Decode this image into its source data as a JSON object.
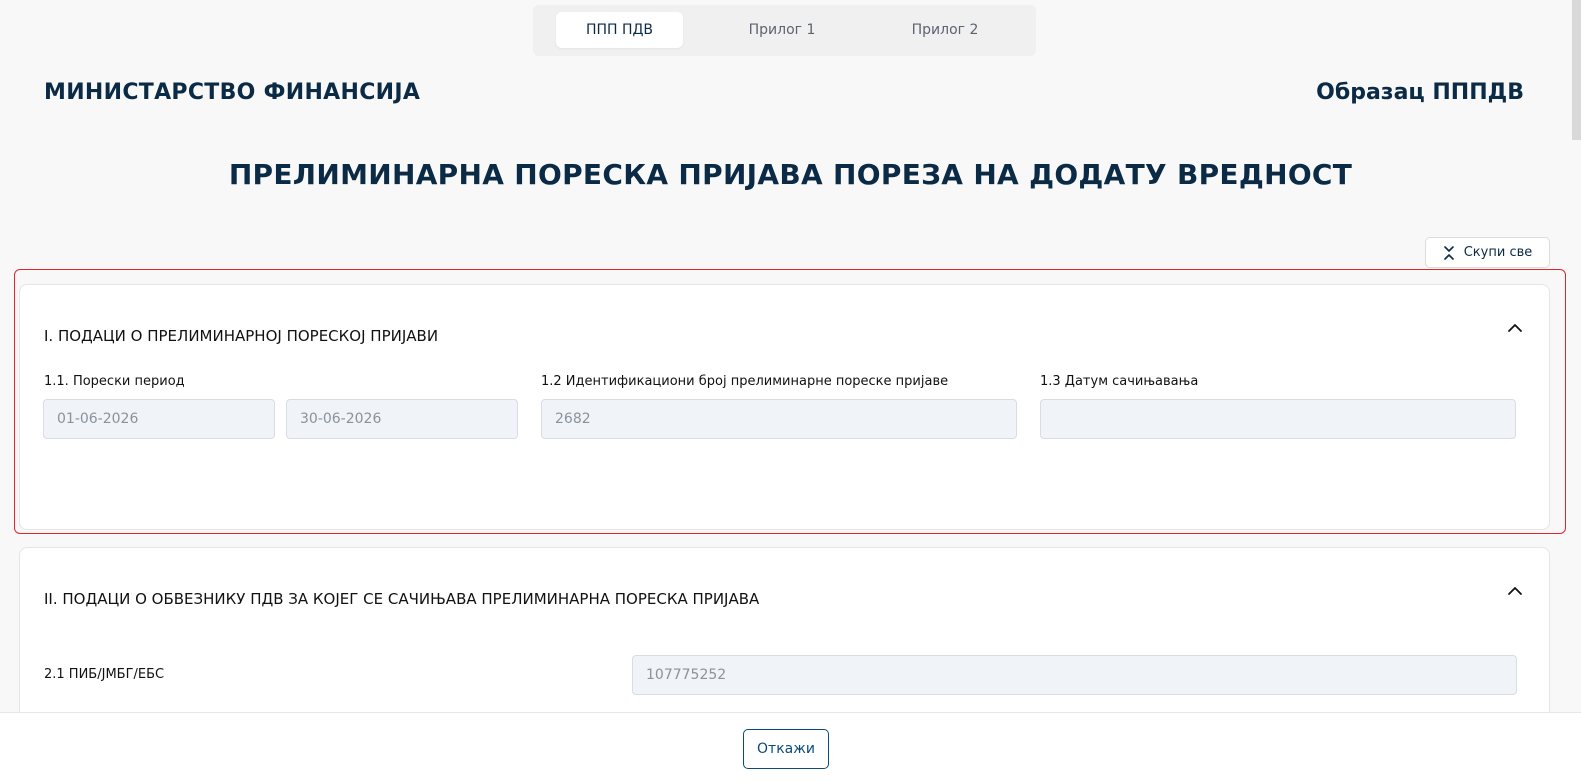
{
  "tabs": [
    {
      "label": "ППП ПДВ",
      "active": true
    },
    {
      "label": "Прилог 1",
      "active": false
    },
    {
      "label": "Прилог 2",
      "active": false
    }
  ],
  "header": {
    "ministry": "МИНИСТАРСТВО ФИНАНСИЈА",
    "form_code": "Образац ПППДВ",
    "title": "ПРЕЛИМИНАРНА ПОРЕСКА ПРИЈАВА ПОРЕЗА НА ДОДАТУ ВРЕДНОСТ"
  },
  "toolbar": {
    "collapse_all_label": "Скупи све",
    "collapse_all_icon": "collapse-icon"
  },
  "section1": {
    "title": "I. ПОДАЦИ О ПРЕЛИМИНАРНОЈ ПОРЕСКОЈ ПРИЈАВИ",
    "chevron_icon": "chevron-up-icon",
    "fields": {
      "period_label": "1.1. Порески период",
      "period_from": "01-06-2026",
      "period_to": "30-06-2026",
      "id_label": "1.2 Идентификациони број прелиминарне пореске пријаве",
      "id_value": "2682",
      "date_label": "1.3 Датум сачињавања",
      "date_value": ""
    }
  },
  "section2": {
    "title": "II. ПОДАЦИ О ОБВЕЗНИКУ ПДВ ЗА КОЈЕГ СЕ САЧИЊАВА ПРЕЛИМИНАРНА ПОРЕСКА ПРИЈАВА",
    "chevron_icon": "chevron-up-icon",
    "fields": {
      "pib_label": "2.1 ПИБ/ЈМБГ/ЕБС",
      "pib_value": "107775252"
    }
  },
  "footer": {
    "cancel_label": "Откажи"
  },
  "colors": {
    "primary_text": "#0b2a45",
    "highlight_border": "#e0262b",
    "input_bg": "#f0f3f7",
    "button_blue": "#0b4a7a"
  }
}
